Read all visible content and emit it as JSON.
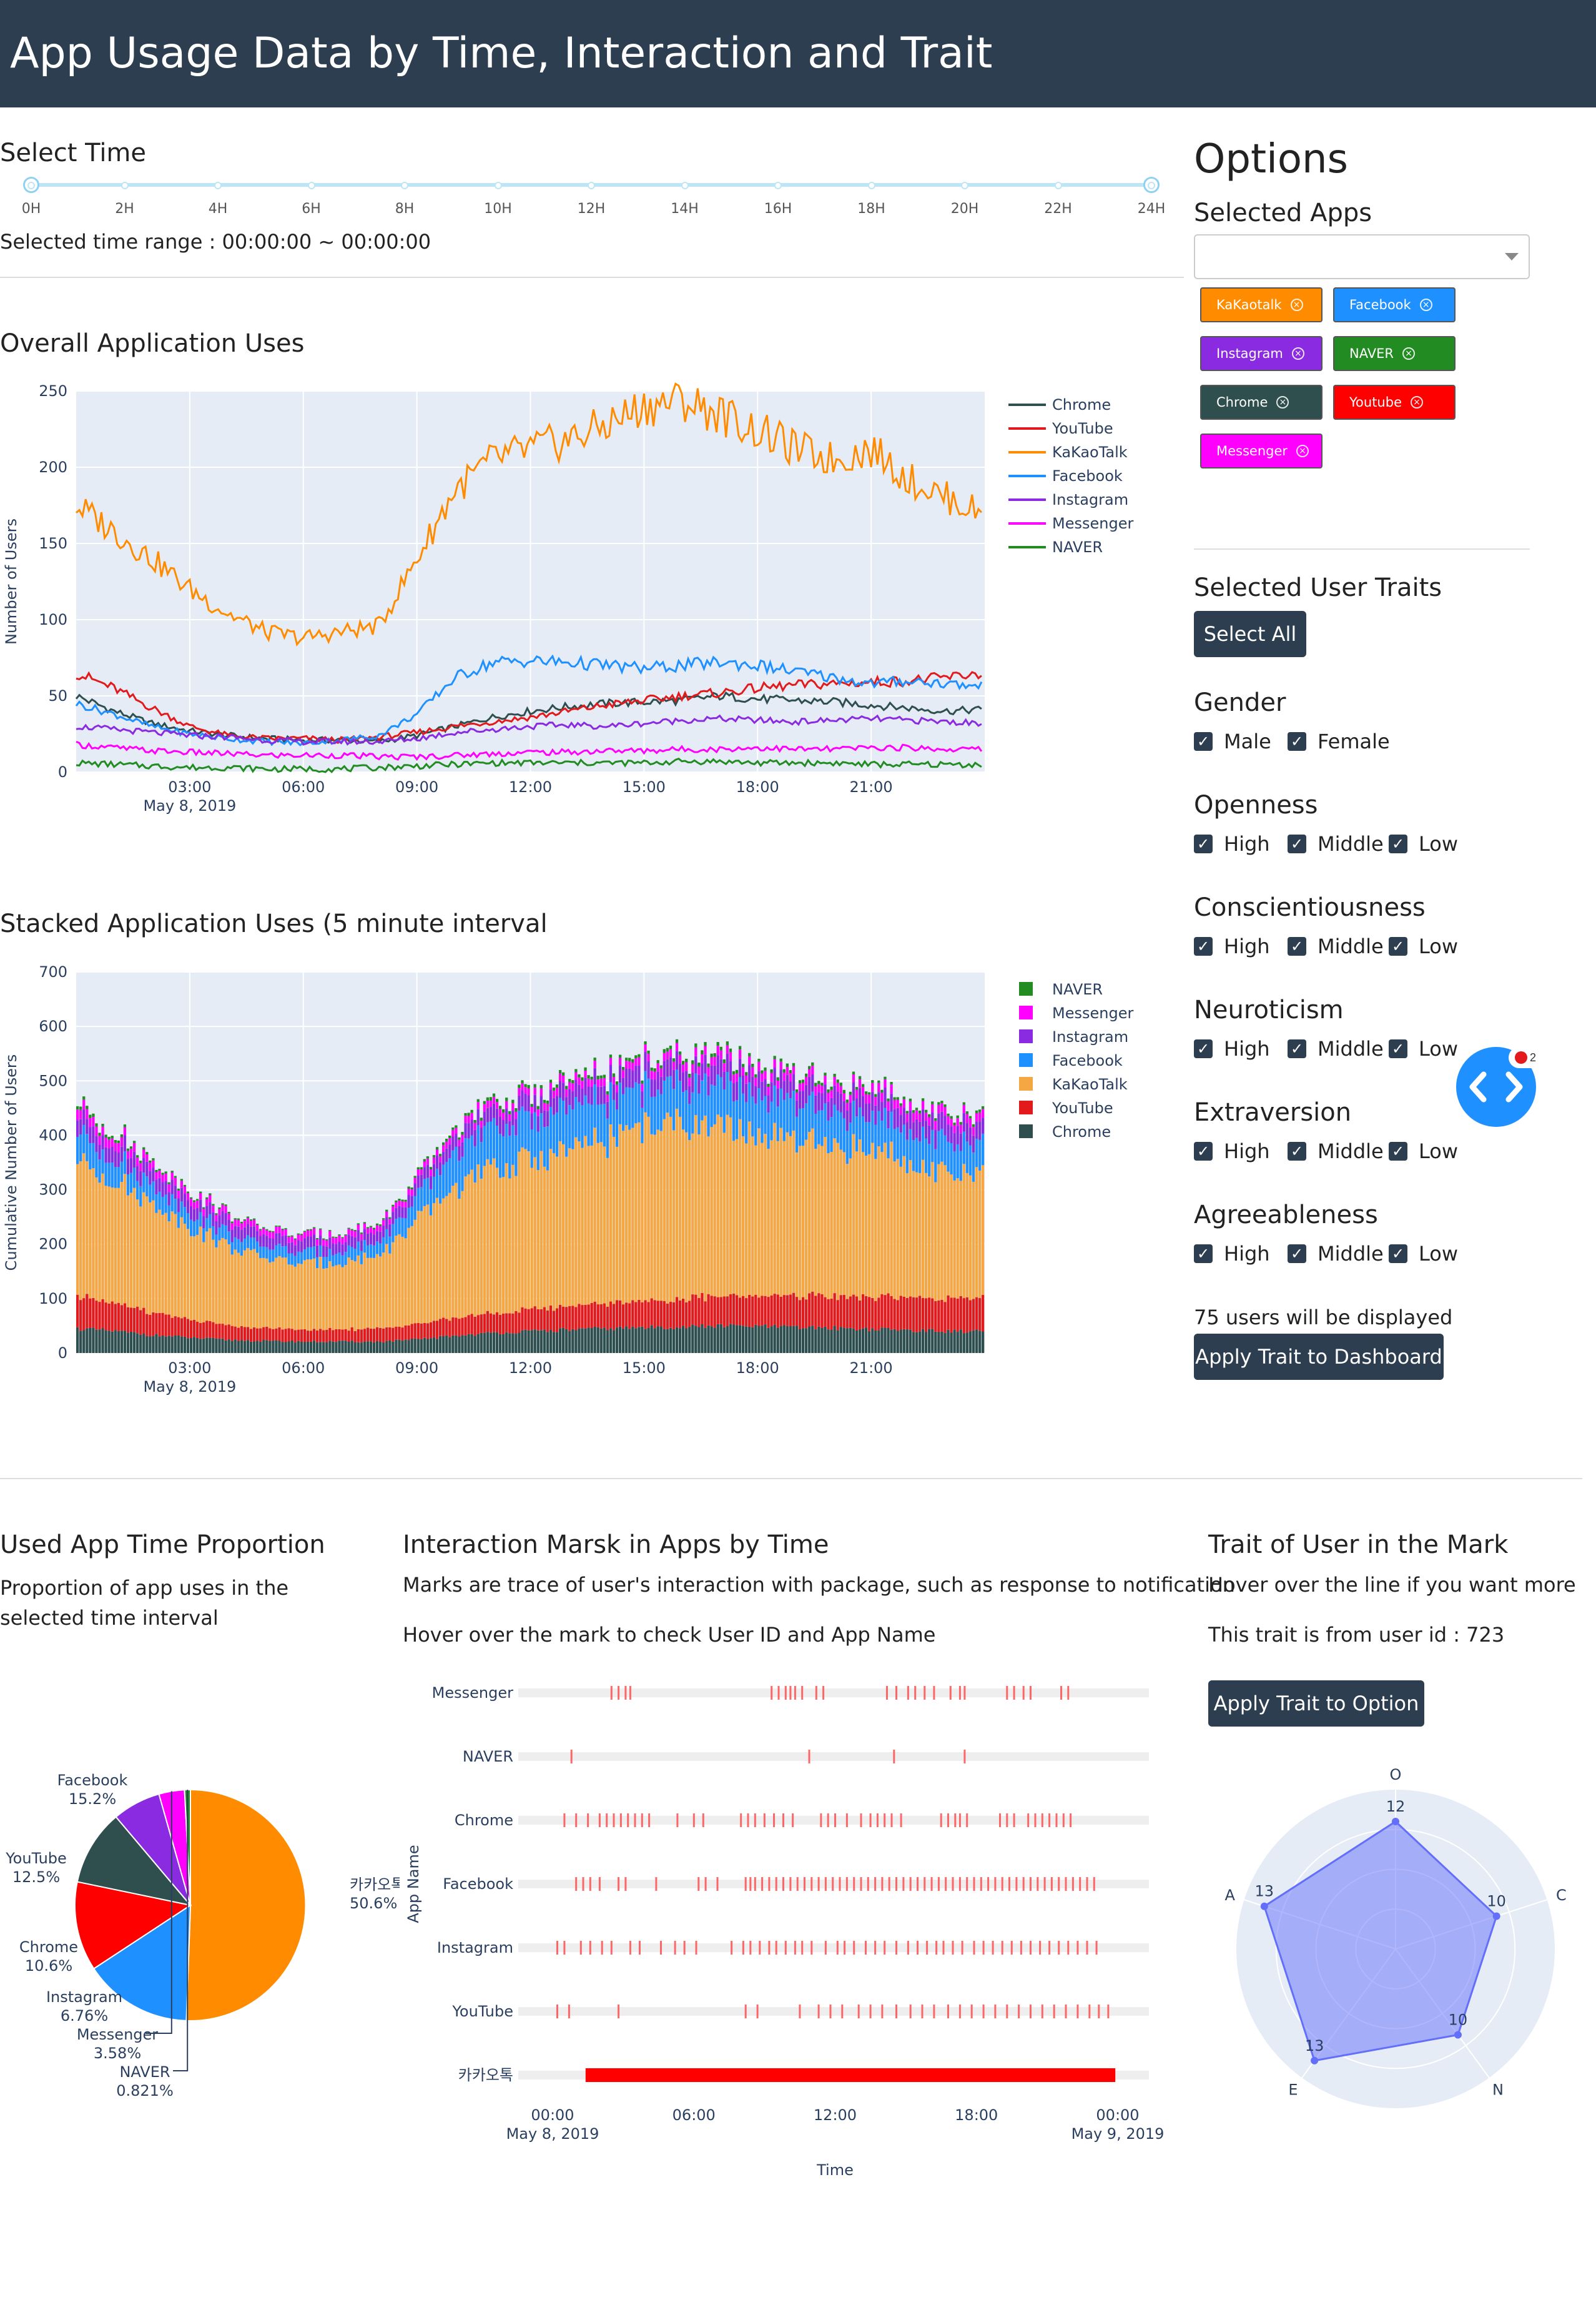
{
  "header": {
    "title": "App Usage Data by Time, Interaction and Trait"
  },
  "time_select": {
    "title": "Select Time",
    "marks": [
      "0H",
      "2H",
      "4H",
      "6H",
      "8H",
      "10H",
      "12H",
      "14H",
      "16H",
      "18H",
      "20H",
      "22H",
      "24H"
    ],
    "range_text": "Selected time range : 00:00:00 ~ 00:00:00",
    "range_start_h": 0,
    "range_end_h": 24
  },
  "options": {
    "title": "Options",
    "apps_label": "Selected Apps",
    "dropdown_value": "",
    "app_chips": [
      {
        "label": "KaKaotalk",
        "color": "#ff8c00"
      },
      {
        "label": "Facebook",
        "color": "#1e90ff"
      },
      {
        "label": "Instagram",
        "color": "#8a2be2"
      },
      {
        "label": "NAVER",
        "color": "#228b22"
      },
      {
        "label": "Chrome",
        "color": "#2f4f4f"
      },
      {
        "label": "Youtube",
        "color": "#ff0000"
      },
      {
        "label": "Messenger",
        "color": "#ff00ff"
      }
    ],
    "traits_label": "Selected User Traits",
    "select_all": "Select All",
    "trait_groups": [
      {
        "name": "Gender",
        "items": [
          "Male",
          "Female"
        ]
      },
      {
        "name": "Openness",
        "items": [
          "High",
          "Middle",
          "Low"
        ]
      },
      {
        "name": "Conscientiousness",
        "items": [
          "High",
          "Middle",
          "Low"
        ]
      },
      {
        "name": "Neuroticism",
        "items": [
          "High",
          "Middle",
          "Low"
        ]
      },
      {
        "name": "Extraversion",
        "items": [
          "High",
          "Middle",
          "Low"
        ]
      },
      {
        "name": "Agreeableness",
        "items": [
          "High",
          "Middle",
          "Low"
        ]
      }
    ],
    "users_text": "75 users will be displayed",
    "apply_button": "Apply Trait to Dashboard",
    "badge_count": "2"
  },
  "bottom": {
    "pie_title": "Used App Time Proportion",
    "pie_desc": "Proportion of app uses in the selected time interval",
    "marks_title": "Interaction Marsk in Apps by Time",
    "marks_desc1": "Marks are trace of user's interaction with package, such as response to notification",
    "marks_desc2": "Hover over the mark to check User ID and App Name",
    "trait_title": "Trait of User in the Mark",
    "trait_desc1": "Hover over the line if you want more",
    "trait_desc2": "This trait is from user id : 723",
    "trait_button": "Apply Trait to Option"
  },
  "chart_data": [
    {
      "id": "overall",
      "type": "line",
      "title": "Overall Application Uses",
      "xlabel": "",
      "date_label": "May 8, 2019",
      "ylabel": "Number of Users",
      "ylim": [
        0,
        250
      ],
      "yticks": [
        0,
        50,
        100,
        150,
        200,
        250
      ],
      "xticks": [
        "03:00",
        "06:00",
        "09:00",
        "12:00",
        "15:00",
        "18:00",
        "21:00"
      ],
      "x_hours": [
        0,
        1,
        2,
        3,
        4,
        5,
        6,
        7,
        8,
        9,
        10,
        11,
        12,
        13,
        14,
        15,
        16,
        17,
        18,
        19,
        20,
        21,
        22,
        23,
        23.9
      ],
      "series": [
        {
          "name": "Chrome",
          "color": "#2f4f4f",
          "values": [
            50,
            40,
            32,
            27,
            24,
            22,
            21,
            21,
            20,
            24,
            30,
            36,
            40,
            43,
            45,
            46,
            47,
            50,
            48,
            47,
            46,
            44,
            42,
            40,
            41
          ]
        },
        {
          "name": "YouTube",
          "color": "#e31a1c",
          "values": [
            65,
            55,
            42,
            30,
            24,
            22,
            22,
            21,
            23,
            26,
            30,
            33,
            36,
            40,
            44,
            47,
            50,
            52,
            55,
            57,
            58,
            59,
            60,
            62,
            65
          ]
        },
        {
          "name": "KaKaoTalk",
          "color": "#ff8c00",
          "values": [
            175,
            158,
            140,
            120,
            104,
            92,
            88,
            92,
            96,
            140,
            185,
            205,
            212,
            218,
            228,
            240,
            244,
            235,
            224,
            212,
            205,
            212,
            192,
            180,
            170
          ]
        },
        {
          "name": "Facebook",
          "color": "#1e90ff",
          "values": [
            45,
            38,
            30,
            25,
            22,
            20,
            19,
            21,
            24,
            38,
            62,
            72,
            73,
            72,
            70,
            68,
            70,
            72,
            70,
            66,
            62,
            58,
            60,
            58,
            56
          ]
        },
        {
          "name": "Instagram",
          "color": "#8a2be2",
          "values": [
            30,
            28,
            26,
            24,
            23,
            21,
            20,
            20,
            20,
            22,
            26,
            28,
            30,
            31,
            30,
            32,
            34,
            35,
            34,
            33,
            34,
            35,
            34,
            33,
            32
          ]
        },
        {
          "name": "Messenger",
          "color": "#ff00ff",
          "values": [
            18,
            16,
            14,
            13,
            12,
            11,
            11,
            11,
            10,
            10,
            11,
            12,
            13,
            13,
            14,
            14,
            15,
            15,
            16,
            15,
            15,
            16,
            16,
            15,
            15
          ]
        },
        {
          "name": "NAVER",
          "color": "#228b22",
          "values": [
            6,
            5,
            4,
            3,
            3,
            2,
            2,
            2,
            3,
            4,
            5,
            6,
            6,
            6,
            6,
            6,
            7,
            7,
            6,
            6,
            6,
            5,
            5,
            5,
            5
          ]
        }
      ]
    },
    {
      "id": "stacked",
      "type": "bar",
      "title": "Stacked Application Uses (5 minute interval",
      "xlabel": "",
      "date_label": "May 8, 2019",
      "ylabel": "Cumulative Number of Users",
      "ylim": [
        0,
        700
      ],
      "yticks": [
        0,
        100,
        200,
        300,
        400,
        500,
        600,
        700
      ],
      "xticks": [
        "03:00",
        "06:00",
        "09:00",
        "12:00",
        "15:00",
        "18:00",
        "21:00"
      ],
      "x_hours": [
        0,
        1,
        2,
        3,
        4,
        5,
        6,
        7,
        8,
        9,
        10,
        11,
        12,
        13,
        14,
        15,
        16,
        17,
        18,
        19,
        20,
        21,
        22,
        23,
        23.9
      ],
      "series": [
        {
          "name": "Chrome",
          "color": "#2f4f4f",
          "values": [
            45,
            40,
            33,
            28,
            24,
            22,
            21,
            21,
            21,
            25,
            32,
            37,
            40,
            43,
            45,
            47,
            48,
            50,
            49,
            47,
            46,
            44,
            42,
            40,
            40
          ]
        },
        {
          "name": "YouTube",
          "color": "#e31a1c",
          "values": [
            60,
            52,
            42,
            32,
            26,
            23,
            22,
            22,
            24,
            28,
            33,
            36,
            40,
            43,
            46,
            49,
            52,
            54,
            56,
            57,
            58,
            58,
            60,
            61,
            63
          ]
        },
        {
          "name": "KaKaoTalk",
          "color": "#f4a742",
          "values": [
            250,
            225,
            200,
            170,
            145,
            128,
            120,
            125,
            135,
            190,
            240,
            265,
            275,
            285,
            300,
            320,
            325,
            310,
            295,
            280,
            270,
            275,
            250,
            232,
            220
          ]
        },
        {
          "name": "Facebook",
          "color": "#1e90ff",
          "values": [
            50,
            42,
            34,
            28,
            24,
            22,
            21,
            22,
            26,
            42,
            65,
            75,
            76,
            75,
            73,
            70,
            72,
            74,
            72,
            68,
            64,
            60,
            60,
            58,
            56
          ]
        },
        {
          "name": "Instagram",
          "color": "#8a2be2",
          "values": [
            30,
            28,
            26,
            24,
            23,
            21,
            20,
            20,
            20,
            22,
            26,
            29,
            30,
            31,
            31,
            33,
            34,
            35,
            34,
            33,
            34,
            35,
            34,
            33,
            32
          ]
        },
        {
          "name": "Messenger",
          "color": "#ff00ff",
          "values": [
            18,
            16,
            14,
            13,
            12,
            11,
            11,
            11,
            10,
            11,
            12,
            13,
            13,
            14,
            14,
            14,
            15,
            16,
            16,
            15,
            15,
            16,
            16,
            15,
            15
          ]
        },
        {
          "name": "NAVER",
          "color": "#228b22",
          "values": [
            6,
            5,
            4,
            3,
            3,
            2,
            2,
            2,
            3,
            4,
            5,
            6,
            6,
            6,
            6,
            6,
            7,
            7,
            6,
            6,
            6,
            5,
            5,
            5,
            5
          ]
        }
      ]
    },
    {
      "id": "pie",
      "type": "pie",
      "labels": [
        "카카오톡",
        "Facebook",
        "YouTube",
        "Chrome",
        "Instagram",
        "Messenger",
        "NAVER"
      ],
      "values": [
        50.6,
        15.2,
        12.5,
        10.6,
        6.76,
        3.58,
        0.821
      ],
      "texts": [
        "50.6%",
        "15.2%",
        "12.5%",
        "10.6%",
        "6.76%",
        "3.58%",
        "0.821%"
      ],
      "colors": [
        "#ff8c00",
        "#1e90ff",
        "#ff0000",
        "#2f4f4f",
        "#8a2be2",
        "#ff00ff",
        "#228b22"
      ]
    },
    {
      "id": "marks",
      "type": "scatter",
      "xlabel": "Time",
      "ylabel": "App Name",
      "categories": [
        "Messenger",
        "NAVER",
        "Chrome",
        "Facebook",
        "Instagram",
        "YouTube",
        "카카오톡"
      ],
      "xticks": [
        "00:00",
        "06:00",
        "12:00",
        "18:00",
        "00:00"
      ],
      "xtick_dates": [
        "May 8, 2019",
        "",
        "",
        "",
        "May 9, 2019"
      ],
      "xlim": [
        0,
        24
      ],
      "marks": {
        "Messenger": [
          2.5,
          2.8,
          3.1,
          3.3,
          9.3,
          9.6,
          9.9,
          10.1,
          10.3,
          10.6,
          11.2,
          11.5,
          14.2,
          14.6,
          15.1,
          15.4,
          15.8,
          16.2,
          16.9,
          17.3,
          17.5,
          19.3,
          19.6,
          20.0,
          20.3,
          21.6,
          21.9
        ],
        "NAVER": [
          0.8,
          10.9,
          14.5,
          17.5
        ],
        "Chrome": [
          0.5,
          1.0,
          1.5,
          2.0,
          2.3,
          2.6,
          2.9,
          3.2,
          3.5,
          3.8,
          4.1,
          5.3,
          6.0,
          6.4,
          8.0,
          8.3,
          8.6,
          9.0,
          9.4,
          9.8,
          10.2,
          11.4,
          11.7,
          12.0,
          12.5,
          13.1,
          13.5,
          13.8,
          14.1,
          14.4,
          14.8,
          16.5,
          16.8,
          17.1,
          17.3,
          17.6,
          19.0,
          19.3,
          19.6,
          20.2,
          20.5,
          20.8,
          21.1,
          21.4,
          21.7,
          22.0
        ],
        "Facebook": [
          1.0,
          1.3,
          1.6,
          2.0,
          2.8,
          3.1,
          4.4,
          6.2,
          6.5,
          7.0,
          8.2,
          8.4,
          8.6,
          8.9,
          9.2,
          9.5,
          9.8,
          10.1,
          10.4,
          10.7,
          11.0,
          11.3,
          11.6,
          11.9,
          12.2,
          12.5,
          12.8,
          13.1,
          13.4,
          13.7,
          14.0,
          14.3,
          14.6,
          14.9,
          15.2,
          15.5,
          15.8,
          16.1,
          16.4,
          16.7,
          17.0,
          17.3,
          17.6,
          17.9,
          18.2,
          18.5,
          18.8,
          19.1,
          19.4,
          19.7,
          20.0,
          20.3,
          20.6,
          20.9,
          21.2,
          21.5,
          21.8,
          22.1,
          22.4,
          22.7,
          23.0
        ],
        "Instagram": [
          0.2,
          0.5,
          1.2,
          1.6,
          2.1,
          2.5,
          3.3,
          3.7,
          4.6,
          5.2,
          5.6,
          6.1,
          7.6,
          8.1,
          8.4,
          8.8,
          9.2,
          9.5,
          9.9,
          10.3,
          10.6,
          11.0,
          11.6,
          12.1,
          12.4,
          12.8,
          13.3,
          13.7,
          14.1,
          14.6,
          15.1,
          15.5,
          15.9,
          16.3,
          16.6,
          17.0,
          17.4,
          17.9,
          18.3,
          18.7,
          19.1,
          19.5,
          19.9,
          20.3,
          20.7,
          21.1,
          21.5,
          21.9,
          22.3,
          22.7,
          23.1
        ],
        "YouTube": [
          0.2,
          0.7,
          2.8,
          8.2,
          8.7,
          10.5,
          11.3,
          11.8,
          12.3,
          13.0,
          13.5,
          14.0,
          14.6,
          15.2,
          15.7,
          16.2,
          16.8,
          17.3,
          17.8,
          18.3,
          18.8,
          19.3,
          19.8,
          20.3,
          20.8,
          21.3,
          21.8,
          22.3,
          22.8,
          23.2,
          23.6
        ],
        "카카오톡": [
          [
            1.4,
            23.9
          ]
        ]
      }
    },
    {
      "id": "radar",
      "type": "radar",
      "axes": [
        "O",
        "C",
        "N",
        "E",
        "A"
      ],
      "values": [
        12,
        10,
        10,
        13,
        13
      ],
      "range": [
        0,
        15
      ],
      "color": "#636efa"
    }
  ]
}
